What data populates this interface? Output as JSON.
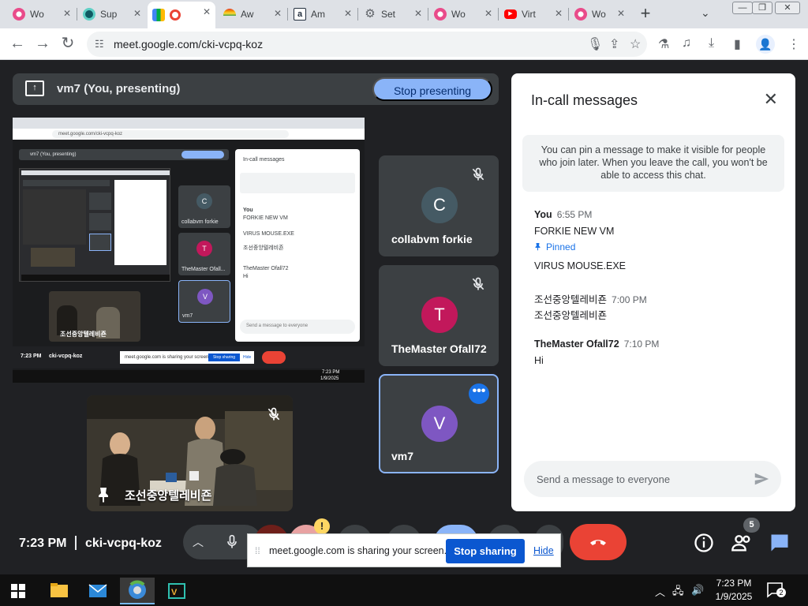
{
  "browser": {
    "tabs": [
      {
        "title": "Wo",
        "favicon": "flower-icon",
        "color": "#e94b8a"
      },
      {
        "title": "Sup",
        "favicon": "chat-bubble-icon",
        "color": "#0e5a63"
      },
      {
        "title": "",
        "favicon": "meet-icon",
        "color": "#00ac47",
        "active": true
      },
      {
        "title": "Aw",
        "favicon": "rainbow-icon",
        "color": "#f29900"
      },
      {
        "title": "Am",
        "favicon": "amazon-icon",
        "color": "#232f3e"
      },
      {
        "title": "Set",
        "favicon": "gear-icon",
        "color": "#5f6368"
      },
      {
        "title": "Wo",
        "favicon": "flower-icon",
        "color": "#e94b8a"
      },
      {
        "title": "Virt",
        "favicon": "youtube-icon",
        "color": "#ff0000"
      },
      {
        "title": "Wo",
        "favicon": "flower-icon",
        "color": "#e94b8a"
      }
    ],
    "url": "meet.google.com/cki-vcpq-koz"
  },
  "meet": {
    "presenting_title": "vm7 (You, presenting)",
    "stop_presenting_label": "Stop presenting",
    "participants": [
      {
        "initial": "C",
        "name": "collabvm forkie",
        "color": "#455a64"
      },
      {
        "initial": "T",
        "name": "TheMaster Ofall72",
        "color": "#c2185b"
      },
      {
        "initial": "V",
        "name": "vm7",
        "color": "#7e57c2"
      }
    ],
    "video_caption": "조선중앙텔레비죤",
    "mini": {
      "present_title": "vm7 (You, presenting)",
      "stop_label": "Stop presenting",
      "panel_title": "In-call messages",
      "tile_names": [
        "collabvm forkie",
        "TheMaster Ofall...",
        "vm7"
      ],
      "clock": "7:23 PM",
      "code": "cki-vcpq-koz",
      "share_text": "meet.google.com is sharing your screen.",
      "share_stop": "Stop sharing",
      "share_hide": "Hide",
      "chat_placeholder": "Send a message to everyone",
      "taskbar_time": "7:23 PM",
      "taskbar_date": "1/9/2025"
    }
  },
  "chat": {
    "title": "In-call messages",
    "info": "You can pin a message to make it visible for people who join later. When you leave the call, you won't be able to access this chat.",
    "messages": [
      {
        "sender": "You",
        "time": "6:55 PM",
        "lines": [
          "FORKIE NEW VM"
        ],
        "pinned": "Pinned",
        "extra": "VIRUS MOUSE.EXE"
      },
      {
        "sender": "조선중앙텔레비죤",
        "time": "7:00 PM",
        "lines": [
          "조선중앙텔레비죤"
        ]
      },
      {
        "sender": "TheMaster Ofall72",
        "time": "7:10 PM",
        "lines": [
          "Hi"
        ]
      }
    ],
    "input_placeholder": "Send a message to everyone"
  },
  "controls": {
    "clock": "7:23 PM",
    "meeting_code": "cki-vcpq-koz",
    "people_count": "5",
    "share_notice": "meet.google.com is sharing your screen.",
    "stop_sharing_label": "Stop sharing",
    "hide_label": "Hide"
  },
  "taskbar": {
    "time": "7:23 PM",
    "date": "1/9/2025",
    "notification_count": "2"
  },
  "colors": {
    "meet_bg": "#202124",
    "accent_blue": "#8ab4f8",
    "end_call_red": "#ea4335",
    "stop_sharing_blue": "#0b57d0"
  }
}
